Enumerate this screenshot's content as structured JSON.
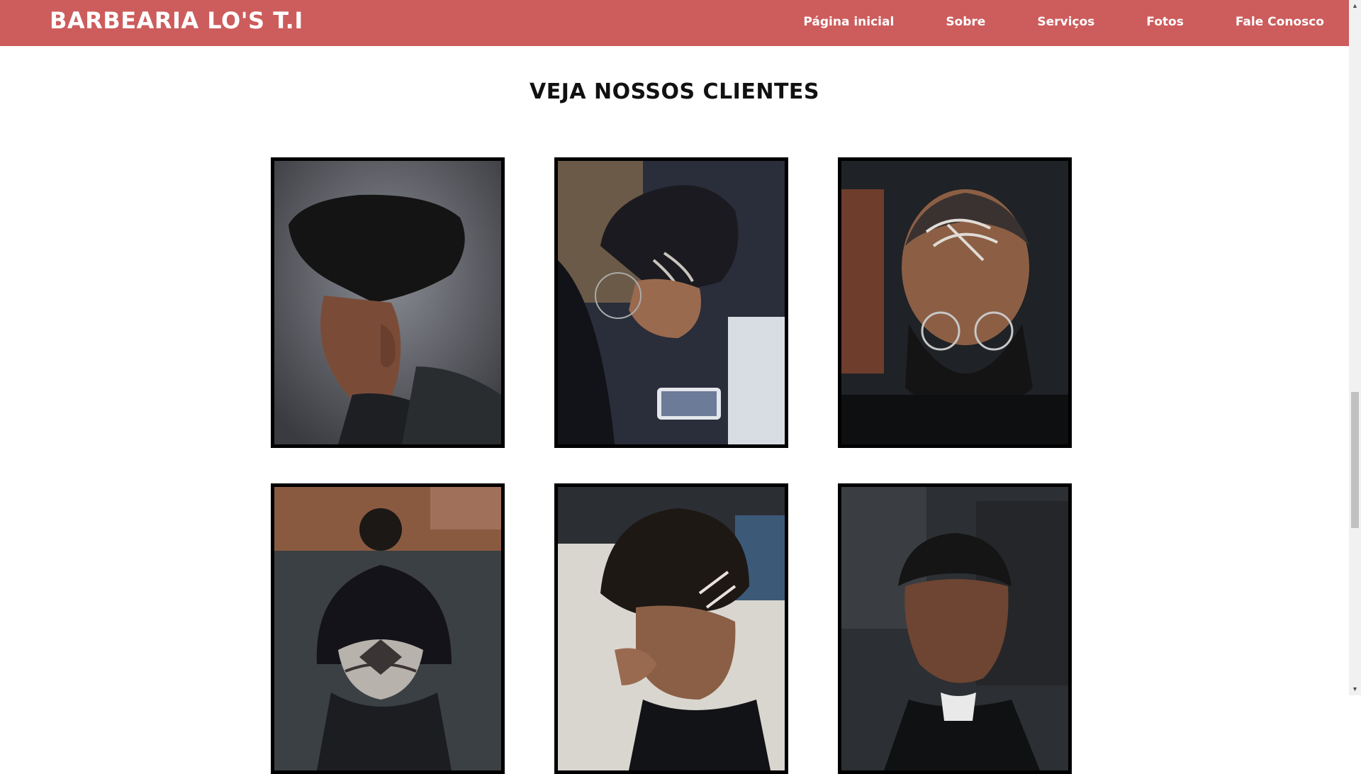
{
  "site": {
    "brand": "BARBEARIA LO'S T.I"
  },
  "nav": {
    "items": [
      {
        "label": "Página inicial"
      },
      {
        "label": "Sobre"
      },
      {
        "label": "Serviços"
      },
      {
        "label": "Fotos"
      },
      {
        "label": "Fale Conosco"
      }
    ]
  },
  "gallery": {
    "title": "VEJA NOSSOS CLIENTES",
    "photos": [
      {
        "icon": "client-photo-high-top-fade"
      },
      {
        "icon": "client-photo-curly-bun-hair-design"
      },
      {
        "icon": "client-photo-bald-fade-line-design-beard"
      },
      {
        "icon": "client-photo-undercut-bun-design"
      },
      {
        "icon": "client-photo-curly-top-fade-design"
      },
      {
        "icon": "client-photo-short-fade"
      }
    ]
  },
  "scrollbar": {
    "position_fraction": 0.62
  },
  "colors": {
    "navbar": "#cd5c5c",
    "nav_text": "#ffffff",
    "title_text": "#111111",
    "photo_border": "#000000"
  }
}
